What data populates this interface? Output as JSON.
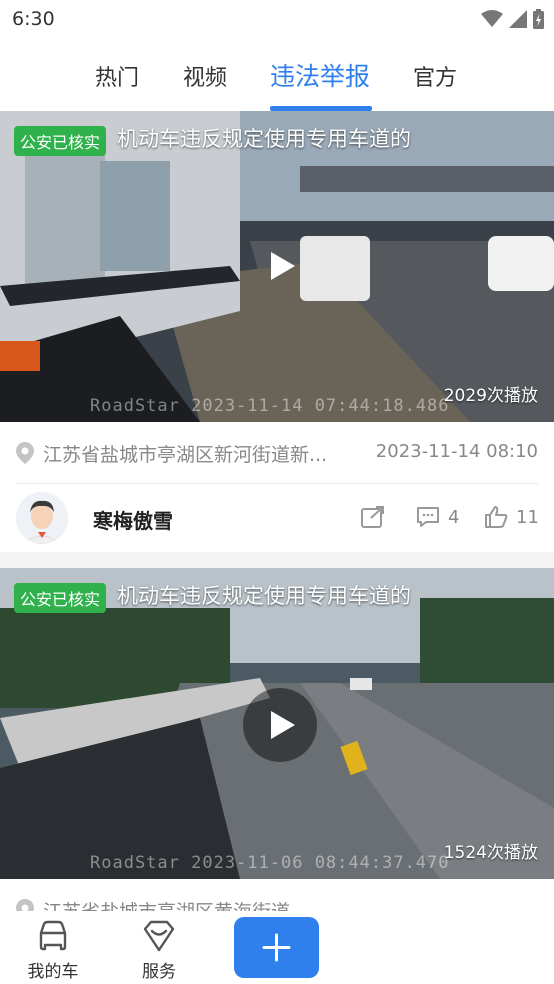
{
  "status_bar": {
    "time": "6:30"
  },
  "tabs": [
    {
      "label": "热门",
      "active": false
    },
    {
      "label": "视频",
      "active": false
    },
    {
      "label": "违法举报",
      "active": true
    },
    {
      "label": "官方",
      "active": false
    }
  ],
  "feed": [
    {
      "badge": "公安已核实",
      "title": "机动车违反规定使用专用车道的",
      "play_count": "2029次播放",
      "watermark": "RoadStar 2023-11-14 07:44:18.486",
      "location": "江苏省盐城市亭湖区新河街道新...",
      "time": "2023-11-14 08:10",
      "user": "寒梅傲雪",
      "comments": "4",
      "likes": "11"
    },
    {
      "badge": "公安已核实",
      "title": "机动车违反规定使用专用车道的",
      "play_count": "1524次播放",
      "watermark": "RoadStar 2023-11-06 08:44:37.470",
      "location": "江苏省盐城市亭湖区黄海街道..."
    }
  ],
  "bottom_nav": {
    "my_car": "我的车",
    "service": "服务"
  },
  "colors": {
    "accent": "#2f80ed",
    "badge": "#2fb24b"
  }
}
